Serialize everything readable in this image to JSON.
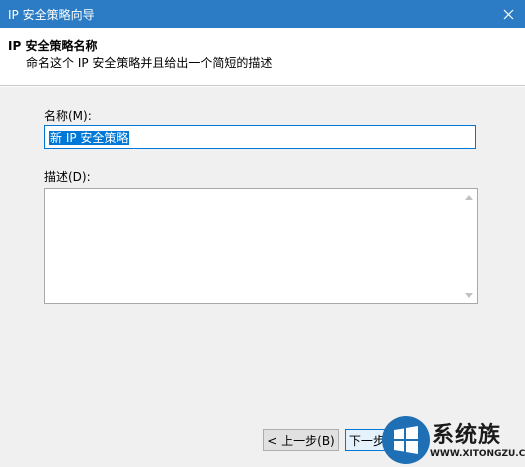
{
  "window": {
    "title": "IP 安全策略向导",
    "close_icon": "close-icon"
  },
  "header": {
    "heading": "IP 安全策略名称",
    "subtitle": "命名这个 IP 安全策略并且给出一个简短的描述"
  },
  "form": {
    "name_label": "名称(M):",
    "name_value": "新 IP 安全策略",
    "description_label": "描述(D):",
    "description_value": ""
  },
  "buttons": {
    "back_label": "< 上一步(B)",
    "next_label": "下一步(N) >"
  },
  "watermark": {
    "text": "系统族",
    "url": "WWW.XITONGZU.COM"
  },
  "colors": {
    "titlebar": "#2b7cc4",
    "accent": "#0078d7"
  }
}
